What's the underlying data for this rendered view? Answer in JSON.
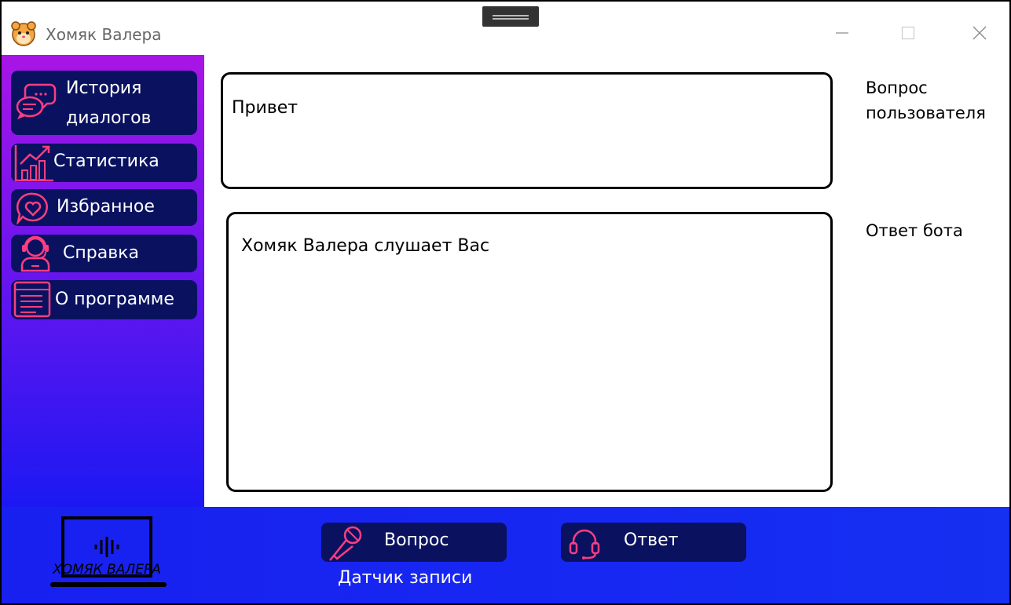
{
  "window": {
    "title": "Хомяк Валера",
    "controls": [
      "minimize",
      "maximize",
      "close"
    ]
  },
  "sidebar": {
    "items": [
      {
        "label_line1": "История",
        "label_line2": "диалогов",
        "icon": "chat-bubbles-icon"
      },
      {
        "label": "Статистика",
        "icon": "chart-growth-icon"
      },
      {
        "label": "Избранное",
        "icon": "heart-bubble-icon"
      },
      {
        "label": "Справка",
        "icon": "support-agent-icon"
      },
      {
        "label": "О программе",
        "icon": "document-icon"
      }
    ]
  },
  "main": {
    "question_text": "Привет",
    "question_label": "Вопрос пользователя",
    "question_label_line1": "Вопрос",
    "question_label_line2": "пользователя",
    "answer_text": "Хомяк Валера слушает Вас",
    "answer_label": "Ответ бота"
  },
  "bottom": {
    "logo_text": "ХОМЯК ВАЛЕРА",
    "question_button": "Вопрос",
    "answer_button": "Ответ",
    "recording_caption": "Датчик записи"
  },
  "colors": {
    "sidebar_top": "#a815e6",
    "sidebar_bottom": "#1b18f2",
    "bottom_bar": "#1728f2",
    "button_bg": "#0a1260",
    "icon_accent": "#ff3d7f"
  }
}
